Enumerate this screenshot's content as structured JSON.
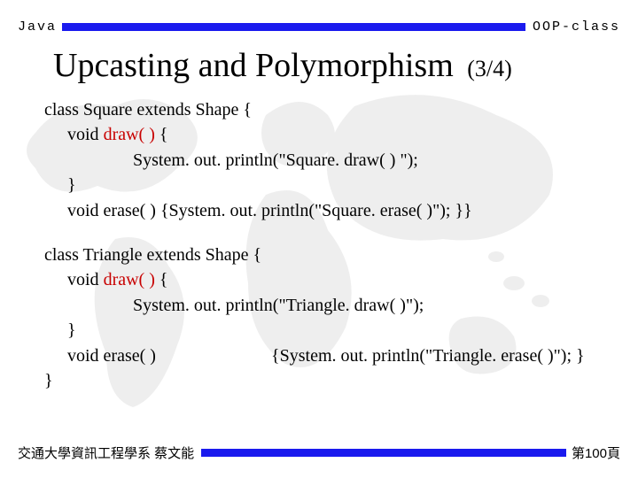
{
  "header": {
    "left": "Java",
    "right": "OOP-class"
  },
  "title": {
    "main": "Upcasting and Polymorphism",
    "pager": "(3/4)"
  },
  "code": {
    "square": {
      "l1": "class Square extends Shape {",
      "l2a": "void ",
      "l2b": "draw( )",
      "l2c": " {",
      "l3": "System. out. println(\"Square. draw( ) \");",
      "l4": "}",
      "l5": "void erase( ) {System. out. println(\"Square. erase( )\"); }}"
    },
    "triangle": {
      "l1": "class Triangle extends Shape {",
      "l2a": "void ",
      "l2b": "draw( )",
      "l2c": " {",
      "l3": "System. out. println(\"Triangle. draw( )\");",
      "l4": "}",
      "l5a": "void erase( )",
      "l5b": "{System. out. println(\"Triangle. erase( )\"); }",
      "l6": "}"
    }
  },
  "footer": {
    "left": "交通大學資訊工程學系 蔡文能",
    "right": "第100頁"
  }
}
